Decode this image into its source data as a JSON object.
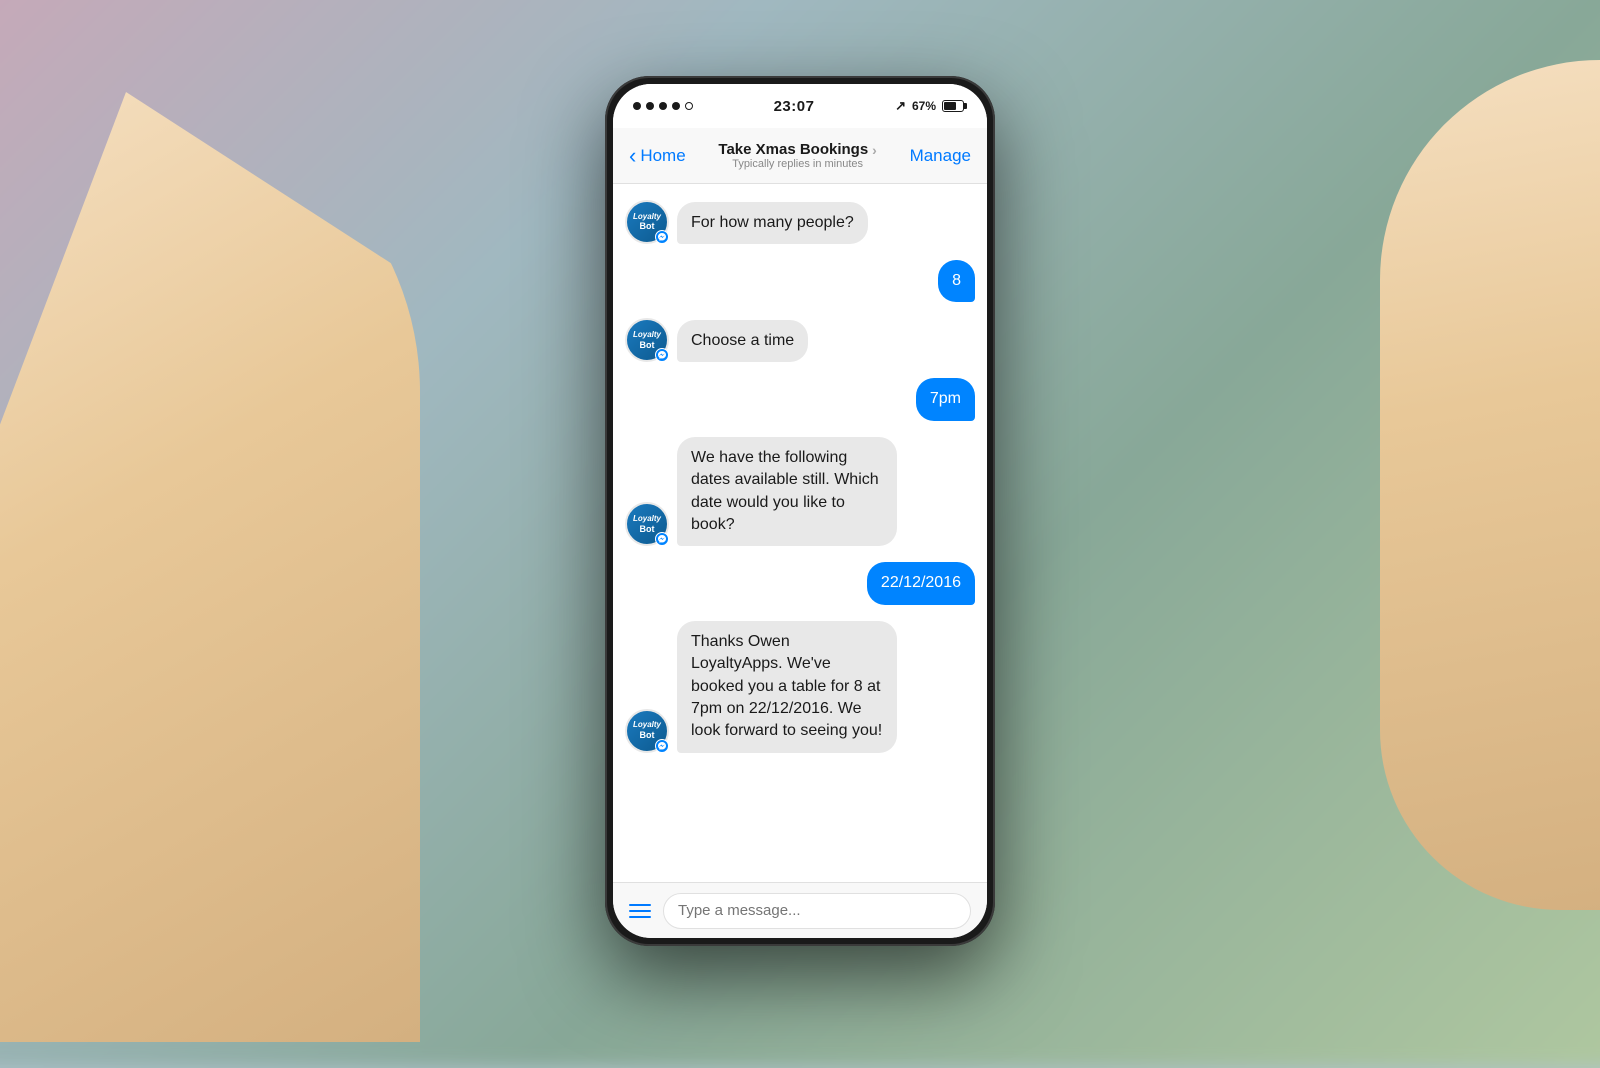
{
  "background": {
    "description": "blurred bokeh background with soft purples, greens, and blues"
  },
  "status_bar": {
    "signal_dots": 4,
    "time": "23:07",
    "battery_percent": "67%"
  },
  "nav": {
    "back_label": "Home",
    "title": "Take Xmas Bookings",
    "chevron": "›",
    "subtitle": "Typically replies in minutes",
    "manage_label": "Manage"
  },
  "messages": [
    {
      "type": "bot",
      "text": "For how many people?"
    },
    {
      "type": "user",
      "text": "8"
    },
    {
      "type": "bot",
      "text": "Choose a time"
    },
    {
      "type": "user",
      "text": "7pm"
    },
    {
      "type": "bot",
      "text": "We have the following dates available still. Which date would you like to book?"
    },
    {
      "type": "user",
      "text": "22/12/2016"
    },
    {
      "type": "bot",
      "text": "Thanks Owen LoyaltyApps. We've booked you a table for 8 at 7pm on 22/12/2016. We look forward to seeing you!"
    }
  ],
  "input_bar": {
    "placeholder": "Type a message..."
  },
  "bot_avatar": {
    "line1": "Loyalty",
    "line2": "Bot"
  }
}
